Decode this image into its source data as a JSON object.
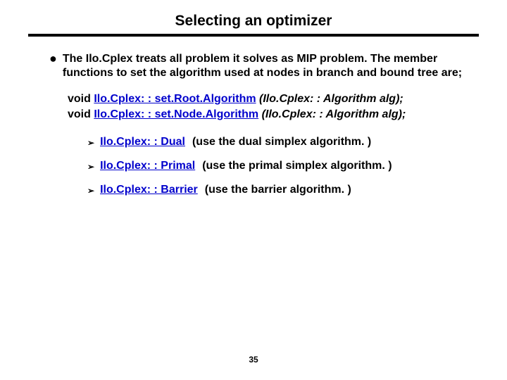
{
  "title": "Selecting an optimizer",
  "bullet1": "The Ilo.Cplex treats all problem it solves as MIP problem. The member functions to set the algorithm used at nodes in branch and bound tree are;",
  "fn1": {
    "kw": "void",
    "link": "Ilo.Cplex: : set.Root.Algorithm",
    "rest": " (Ilo.Cplex: : Algorithm alg);"
  },
  "fn2": {
    "kw": "void",
    "link": "Ilo.Cplex: : set.Node.Algorithm",
    "rest": " (Ilo.Cplex: : Algorithm alg);"
  },
  "sub": [
    {
      "link": "Ilo.Cplex: : Dual",
      "desc": "(use the dual simplex algorithm. )"
    },
    {
      "link": "Ilo.Cplex: : Primal",
      "desc": "(use the primal simplex algorithm. )"
    },
    {
      "link": "Ilo.Cplex: : Barrier",
      "desc": "(use the barrier algorithm. )"
    }
  ],
  "pageNumber": "35"
}
